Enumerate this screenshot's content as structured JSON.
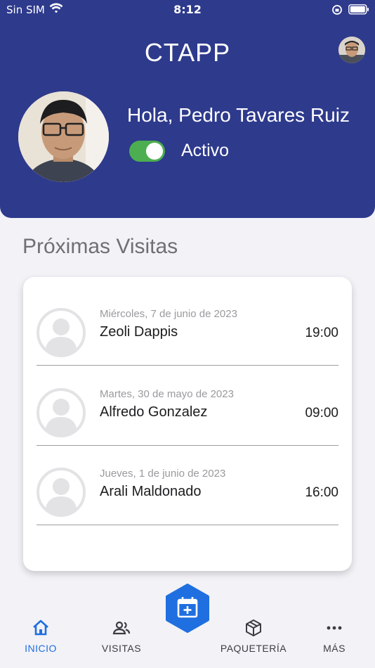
{
  "status_bar": {
    "carrier": "Sin SIM",
    "time": "8:12"
  },
  "header": {
    "app_title": "CTAPP",
    "greeting": "Hola, Pedro Tavares Ruiz",
    "status_label": "Activo",
    "status_active": true
  },
  "visits": {
    "section_title": "Próximas Visitas",
    "items": [
      {
        "date": "Miércoles, 7 de junio de 2023",
        "name": "Zeoli Dappis",
        "time": "19:00"
      },
      {
        "date": "Martes, 30 de mayo de 2023",
        "name": "Alfredo Gonzalez",
        "time": "09:00"
      },
      {
        "date": "Jueves, 1 de junio de 2023",
        "name": "Arali Maldonado",
        "time": "16:00"
      }
    ]
  },
  "tabbar": {
    "tabs": [
      {
        "label": "INICIO",
        "icon": "home-icon",
        "active": true
      },
      {
        "label": "VISITAS",
        "icon": "people-icon",
        "active": false
      },
      {
        "label": "PAQUETERÍA",
        "icon": "package-icon",
        "active": false
      },
      {
        "label": "MÁS",
        "icon": "more-icon",
        "active": false
      }
    ],
    "fab_icon": "calendar-add-icon"
  },
  "colors": {
    "primary": "#2e3a8c",
    "accent": "#1f6fe0",
    "toggle_on": "#4cae50"
  }
}
